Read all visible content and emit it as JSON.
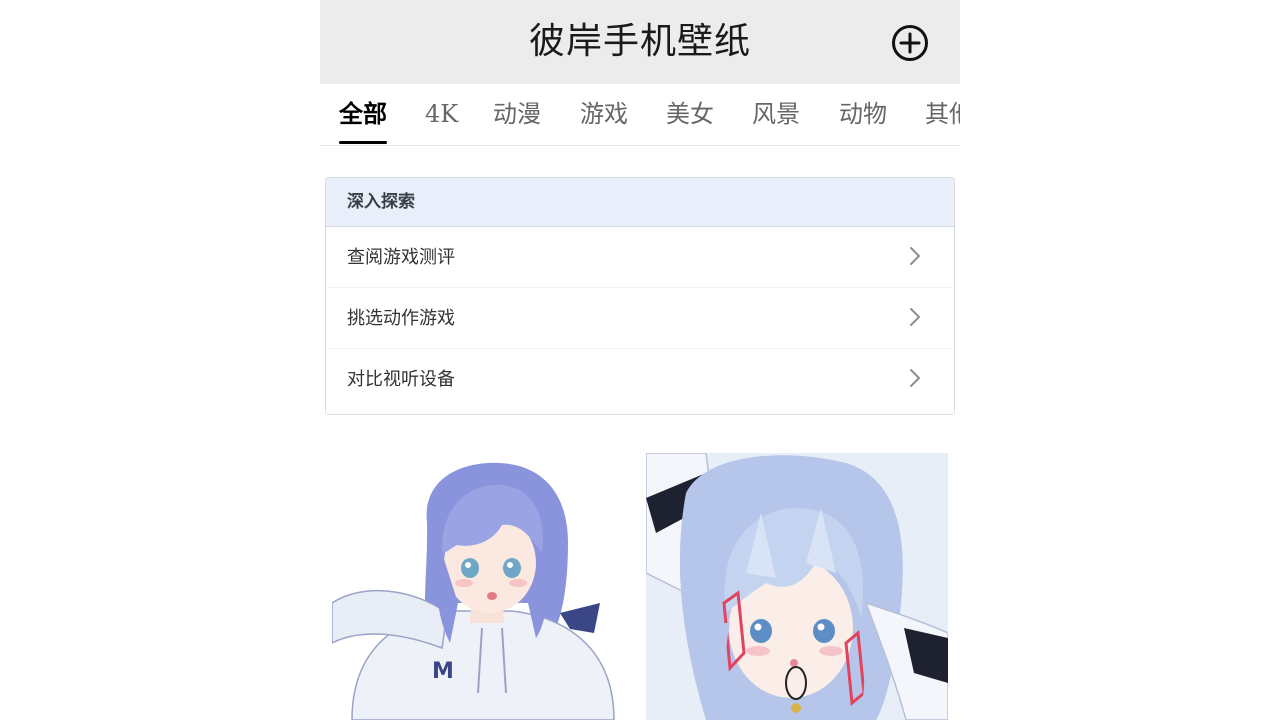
{
  "header": {
    "title": "彼岸手机壁纸",
    "add_icon": "plus-circle-icon"
  },
  "tabs": [
    {
      "label": "全部",
      "active": true
    },
    {
      "label": "4K",
      "active": false
    },
    {
      "label": "动漫",
      "active": false
    },
    {
      "label": "游戏",
      "active": false
    },
    {
      "label": "美女",
      "active": false
    },
    {
      "label": "风景",
      "active": false
    },
    {
      "label": "动物",
      "active": false
    },
    {
      "label": "其他",
      "active": false
    }
  ],
  "explore": {
    "title": "深入探索",
    "items": [
      {
        "label": "查阅游戏测评",
        "icon": "chevron-right-icon"
      },
      {
        "label": "挑选动作游戏",
        "icon": "chevron-right-icon"
      },
      {
        "label": "对比视听设备",
        "icon": "chevron-right-icon"
      }
    ]
  },
  "gallery": {
    "items": [
      {
        "subject": "anime girl with short blue-lavender hair in white hoodie"
      },
      {
        "subject": "anime girl with long light-blue hair and red ribbons"
      }
    ]
  },
  "colors": {
    "header_bg": "#ececec",
    "explore_head_bg": "#e8effb",
    "active_tab": "#000000",
    "inactive_tab": "#666666"
  }
}
